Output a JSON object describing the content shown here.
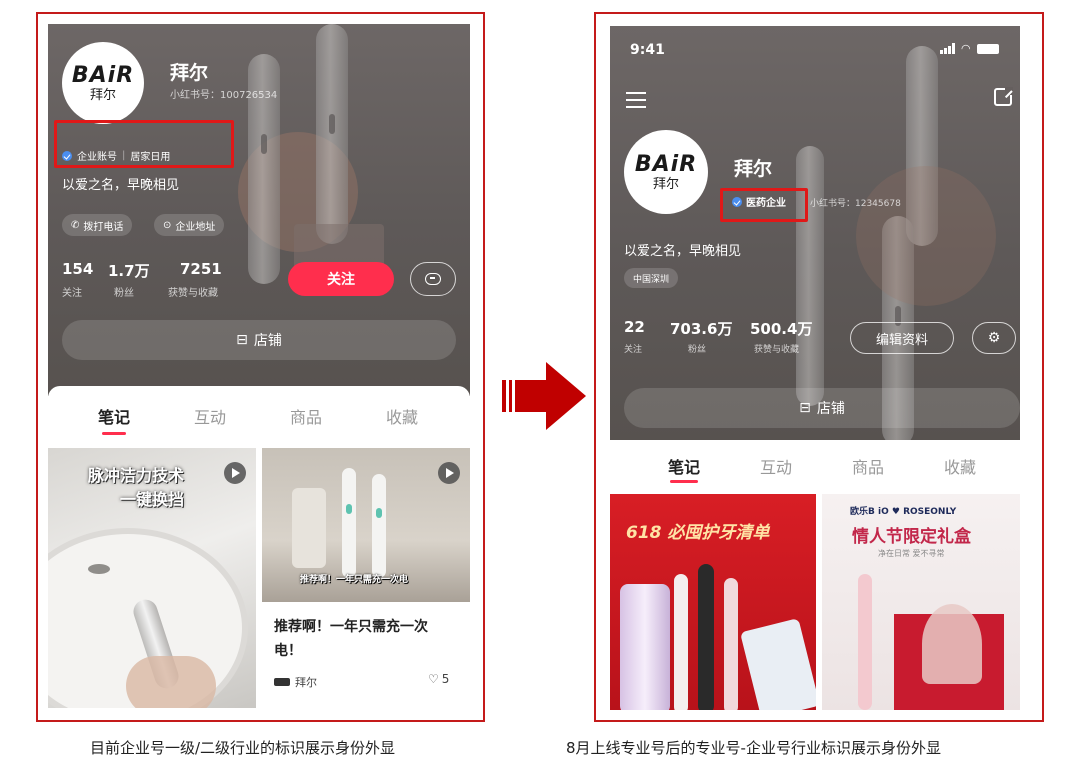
{
  "left": {
    "brand_logo": "BAiR",
    "brand_logo_sub": "拜尔",
    "name": "拜尔",
    "redbook_id": "小红书号：100726534",
    "badge_type": "企业账号",
    "badge_industry": "居家日用",
    "bio": "以爱之名，早晚相见",
    "chips": [
      "拨打电话",
      "企业地址"
    ],
    "stats": [
      {
        "value": "154",
        "label": "关注"
      },
      {
        "value": "1.7万",
        "label": "粉丝"
      },
      {
        "value": "7251",
        "label": "获赞与收藏"
      }
    ],
    "follow_label": "关注",
    "store_label": "店铺",
    "tabs": [
      "笔记",
      "互动",
      "商品",
      "收藏"
    ],
    "card1_overlay_line1": "脉冲洁力技术",
    "card1_overlay_line2": "一键换挡",
    "card2_overlay": "推荐啊！一年只需充一次电",
    "card2_title_line1": "推荐啊！一年只需充一次",
    "card2_title_line2": "电！",
    "card2_author": "拜尔",
    "card2_likes": "5"
  },
  "right": {
    "status_time": "9:41",
    "brand_logo": "BAiR",
    "brand_logo_sub": "拜尔",
    "name": "拜尔",
    "badge_industry": "医药企业",
    "redbook_id": "小红书号：12345678",
    "bio": "以爱之名，早晚相见",
    "location_chip": "中国深圳",
    "stats": [
      {
        "value": "22",
        "label": "关注"
      },
      {
        "value": "703.6万",
        "label": "粉丝"
      },
      {
        "value": "500.4万",
        "label": "获赞与收藏"
      }
    ],
    "edit_label": "编辑资料",
    "store_label": "店铺",
    "tabs": [
      "笔记",
      "互动",
      "商品",
      "收藏"
    ],
    "card1_title": "618 必囤护牙清单",
    "card2_brands": "欧乐B iO ♥ ROSEONLY",
    "card2_title": "情人节限定礼盒",
    "card2_sub": "净在日常 爱不寻常"
  },
  "captions": {
    "left": "目前企业号一级/二级行业的标识展示身份外显",
    "right": "8月上线专业号后的专业号-企业号行业标识展示身份外显"
  },
  "colors": {
    "highlight_red": "#e01818",
    "accent_pink": "#ff2e4d",
    "arrow_red": "#c00000",
    "verified_blue": "#4a8ef0"
  }
}
